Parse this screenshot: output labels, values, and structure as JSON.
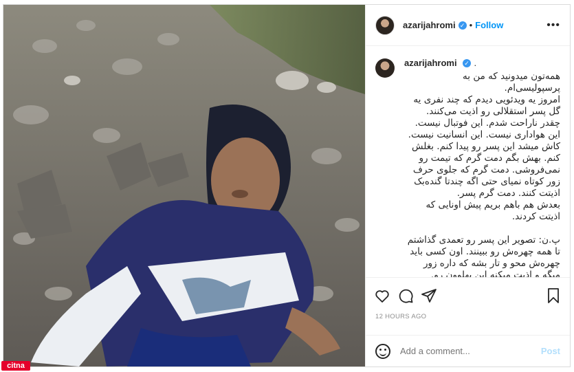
{
  "header": {
    "username": "azarijahromi",
    "verified_mark": "✓",
    "separator": "•",
    "follow_label": "Follow",
    "more_label": "•••"
  },
  "caption": {
    "username": "azarijahromi",
    "verified_mark": "✓",
    "suffix": ".",
    "text": "همه‌تون میدونید که من به پرسپولیسی‌ام.\nامروز یه ویدئویی دیدم که چند نفری یه گل پسر استقلالی رو اذیت می‌کنند. چقدر ناراحت شدم. این فوتبال نیست. این هواداری نیست. این انسانیت نیست.\nکاش میشد این پسر رو پیدا کنم. بغلش کنم. بهش بگم دمت گرم که تیمت رو نمی‌فروشی. دمت گرم که جلوی حرف زور کوتاه نمیای حتی اگه چندتا گنده‌بک اذیتت کنند. دمت گرم پسر.\nبعدش هم باهم بریم پیش اونایی که اذیتت کردند.\n\nپ.ن: تصویر این پسر رو تعمدی گذاشتم تا همه چهره‌ش رو ببینند. اون کسی باید چهره‌ش محو و تار بشه که داره زور میگه و اذیت میکنه این پهلوون رو.\n\nو ..."
  },
  "actions": {
    "like_icon": "heart-icon",
    "comment_icon": "comment-icon",
    "share_icon": "share-icon",
    "save_icon": "bookmark-icon"
  },
  "timestamp": "12 HOURS AGO",
  "comment_box": {
    "emoji_icon": "emoji-icon",
    "placeholder": "Add a comment...",
    "post_label": "Post"
  },
  "watermark": "citna",
  "colors": {
    "accent": "#0095f6",
    "verified": "#3897f0",
    "post_disabled": "#b2dffc",
    "watermark": "#e5002b"
  }
}
